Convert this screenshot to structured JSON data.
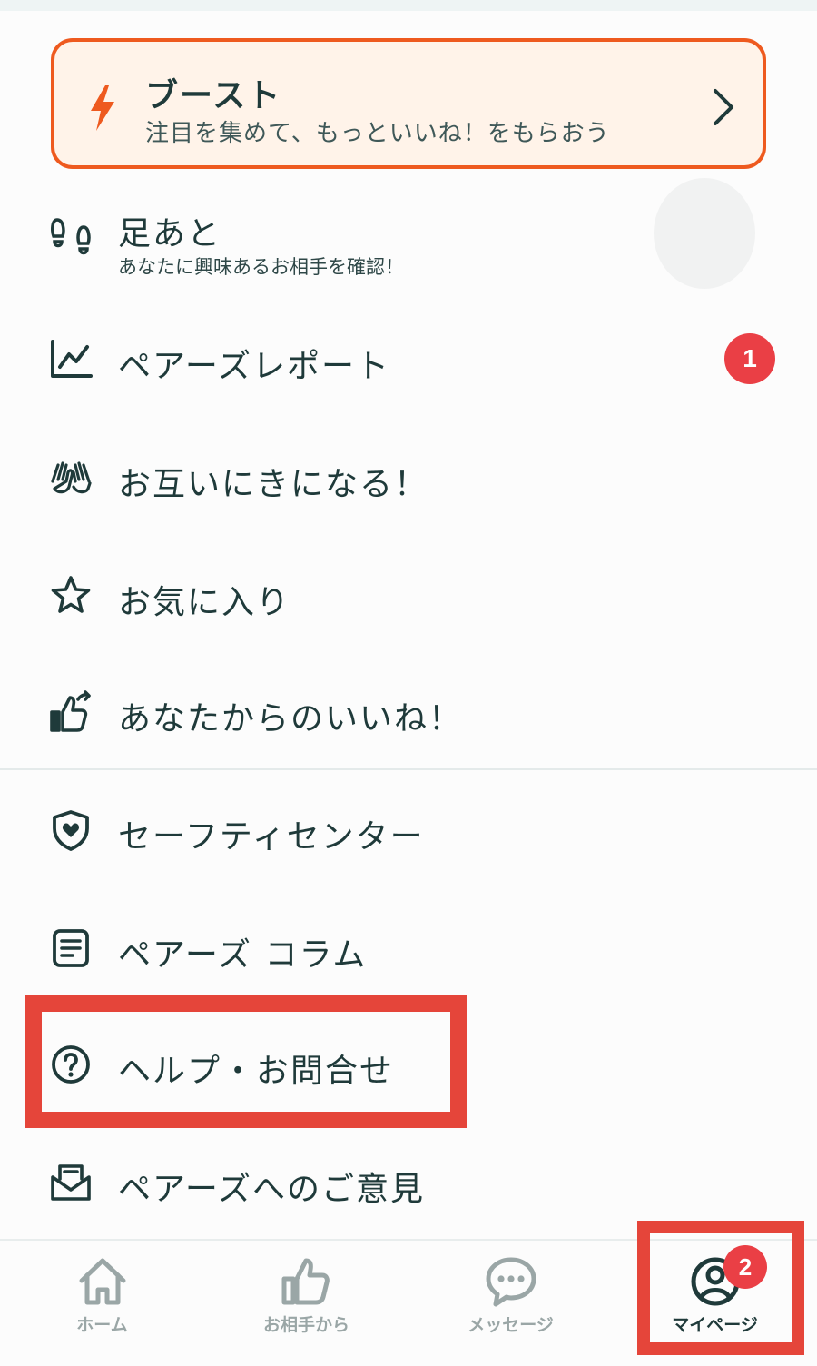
{
  "boost": {
    "title": "ブースト",
    "subtitle": "注目を集めて、もっといいね！をもらおう"
  },
  "menu": {
    "footprints": {
      "label": "足あと",
      "sub": "あなたに興味あるお相手を確認！"
    },
    "report": {
      "label": "ペアーズレポート",
      "badge": "1"
    },
    "mutual": {
      "label": "お互いにきになる！"
    },
    "favorites": {
      "label": "お気に入り"
    },
    "sent_likes": {
      "label": "あなたからのいいね！"
    },
    "safety": {
      "label": "セーフティセンター"
    },
    "column": {
      "label": "ペアーズ コラム"
    },
    "help": {
      "label": "ヘルプ・お問合せ"
    },
    "feedback": {
      "label": "ペアーズへのご意見"
    }
  },
  "tabs": {
    "home": "ホーム",
    "from_partner": "お相手から",
    "messages": "メッセージ",
    "mypage": "マイページ",
    "mypage_badge": "2"
  },
  "colors": {
    "accent": "#ee5a1f",
    "badge": "#ea3f45",
    "highlight": "#e5453a",
    "text": "#1f3a3a"
  }
}
